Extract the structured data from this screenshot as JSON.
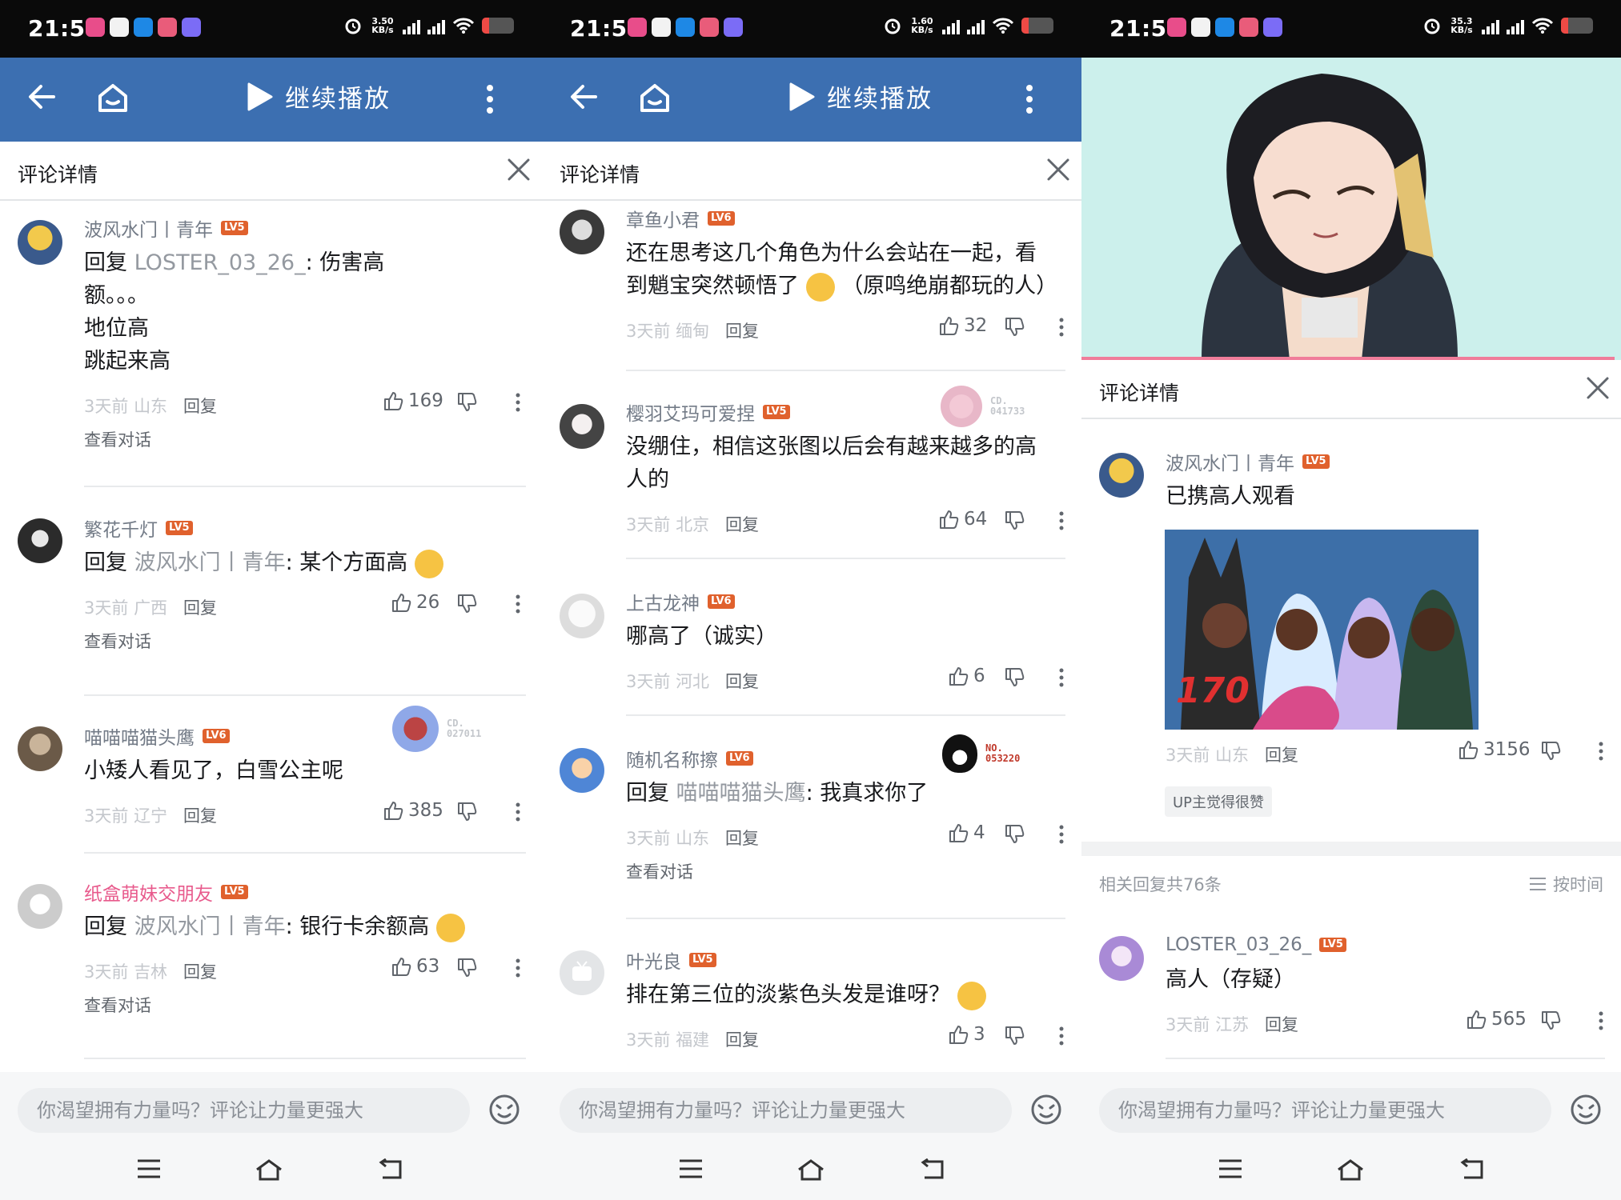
{
  "panels": [
    {
      "status": {
        "time": "21:57",
        "speed_value": "3.50",
        "speed_unit": "KB/s"
      },
      "toolbar": {
        "play_label": "继续播放"
      },
      "header": {
        "title": "评论详情"
      },
      "comments": [
        {
          "user": "波风水门丨青年",
          "level": "LV5",
          "reply_prefix": "回复 ",
          "reply_to": "LOSTER_03_26_",
          "text": ": 伤害高\n额。。。\n地位高\n跳起来高",
          "time": "3天前",
          "location": "山东",
          "reply": "回复",
          "likes": "169",
          "conversation": "查看对话"
        },
        {
          "user": "繁花千灯",
          "level": "LV5",
          "reply_prefix": "回复 ",
          "reply_to": "波风水门丨青年",
          "text": ": 某个方面高",
          "time": "3天前",
          "location": "广西",
          "reply": "回复",
          "likes": "26",
          "conversation": "查看对话"
        },
        {
          "user": "喵喵喵猫头鹰",
          "level": "LV6",
          "badge": {
            "line1": "CD.",
            "line2": "027011"
          },
          "text": "小矮人看见了，白雪公主呢",
          "time": "3天前",
          "location": "辽宁",
          "reply": "回复",
          "likes": "385"
        },
        {
          "user": "纸盒萌妹交朋友",
          "level": "LV5",
          "reply_prefix": "回复 ",
          "reply_to": "波风水门丨青年",
          "text": ": 银行卡余额高",
          "time": "3天前",
          "location": "吉林",
          "reply": "回复",
          "likes": "63",
          "conversation": "查看对话"
        }
      ],
      "input": {
        "placeholder": "你渴望拥有力量吗？评论让力量更强大"
      }
    },
    {
      "status": {
        "time": "21:57",
        "speed_value": "1.60",
        "speed_unit": "KB/s"
      },
      "toolbar": {
        "play_label": "继续播放"
      },
      "header": {
        "title": "评论详情"
      },
      "comments": [
        {
          "user": "章鱼小君",
          "level": "LV6",
          "text": "还在思考这几个角色为什么会站在一起，看\n到魈宝突然顿悟了",
          "text2": "（原鸣绝崩都玩的人）",
          "time": "3天前",
          "location": "缅甸",
          "reply": "回复",
          "likes": "32"
        },
        {
          "user": "樱羽艾玛可爱捏",
          "level": "LV5",
          "badge": {
            "line1": "CD.",
            "line2": "041733"
          },
          "text": "没绷住，相信这张图以后会有越来越多的高\n人的",
          "time": "3天前",
          "location": "北京",
          "reply": "回复",
          "likes": "64"
        },
        {
          "user": "上古龙神",
          "level": "LV6",
          "text": "哪高了（诚实）",
          "time": "3天前",
          "location": "河北",
          "reply": "回复",
          "likes": "6"
        },
        {
          "user": "随机名称擦",
          "level": "LV6",
          "badge": {
            "line1": "NO.",
            "line2": "053220"
          },
          "reply_prefix": "回复 ",
          "reply_to": "喵喵喵猫头鹰",
          "text": ": 我真求你了",
          "time": "3天前",
          "location": "山东",
          "reply": "回复",
          "likes": "4",
          "conversation": "查看对话"
        },
        {
          "user": "叶光良",
          "level": "LV5",
          "text": "排在第三位的淡紫色头发是谁呀？",
          "time": "3天前",
          "location": "福建",
          "reply": "回复",
          "likes": "3"
        }
      ],
      "input": {
        "placeholder": "你渴望拥有力量吗？评论让力量更强大"
      }
    },
    {
      "status": {
        "time": "21:59",
        "speed_value": "35.3",
        "speed_unit": "KB/s"
      },
      "header": {
        "title": "评论详情"
      },
      "main_comment": {
        "user": "波风水门丨青年",
        "level": "LV5",
        "text": "已携高人观看",
        "image_caption": "170",
        "time": "3天前",
        "location": "山东",
        "reply": "回复",
        "likes": "3156",
        "up_badge": "UP主觉得很赞"
      },
      "related": {
        "count_text": "相关回复共76条",
        "sort_label": "按时间"
      },
      "comments": [
        {
          "user": "LOSTER_03_26_",
          "level": "LV5",
          "text": "高人（存疑）",
          "time": "3天前",
          "location": "江苏",
          "reply": "回复",
          "likes": "565"
        }
      ],
      "input": {
        "placeholder": "你渴望拥有力量吗？评论让力量更强大"
      }
    }
  ],
  "colors": {
    "toolbar": "#3c6fb1",
    "level_badge": "#e0612d",
    "pink_name": "#e85a8c",
    "accent_line": "#f07c9a"
  }
}
